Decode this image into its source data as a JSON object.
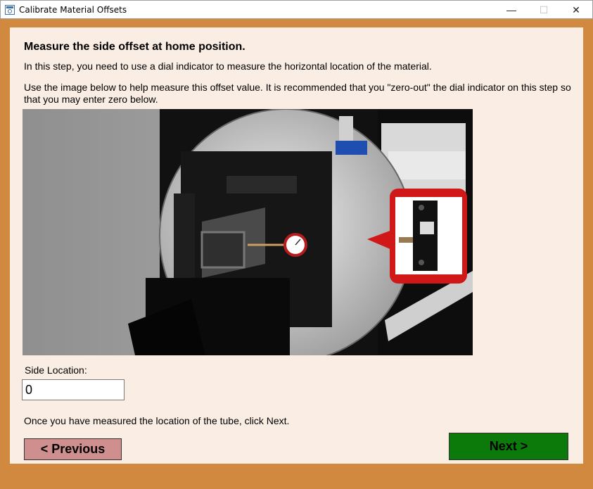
{
  "window": {
    "title": "Calibrate Material Offsets",
    "controls": {
      "minimize": "—",
      "maximize": "☐",
      "close": "✕"
    }
  },
  "content": {
    "heading": "Measure the side offset at home position.",
    "paragraph1": "In this step, you need to use a dial indicator to measure the horizontal location of the material.",
    "paragraph2": "Use the image below to help measure this offset value. It is recommended that you \"zero-out\" the dial indicator on this step so that you may enter zero below.",
    "side_location_label": "Side Location:",
    "side_location_value": "0",
    "footer_text": "Once you have measured the location of the tube, click Next."
  },
  "buttons": {
    "previous": "< Previous",
    "next": "Next >"
  },
  "colors": {
    "frame": "#d1893f",
    "panel": "#faeee4",
    "previous_button": "#d08f8f",
    "next_button": "#0b7a0b"
  }
}
